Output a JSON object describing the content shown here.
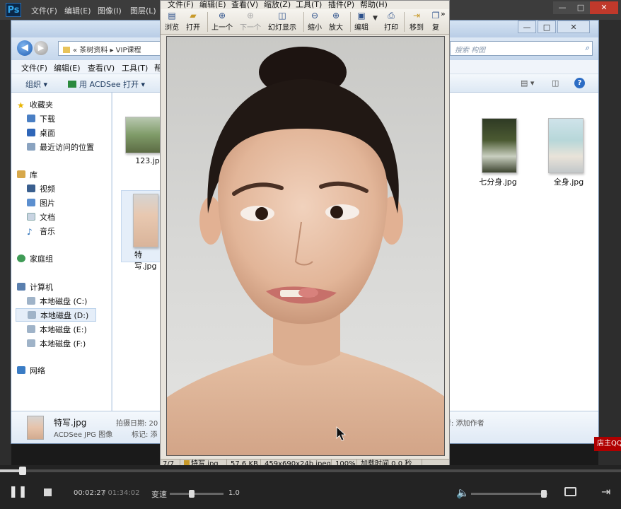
{
  "photoshop": {
    "logo": "Ps",
    "menus": [
      "文件(F)",
      "编辑(E)",
      "图像(I)",
      "图层(L)"
    ],
    "window_controls": [
      "—",
      "□",
      "✕"
    ]
  },
  "explorer": {
    "window_controls": [
      "—",
      "□",
      "✕"
    ],
    "address": "« 茶树资料 ▸ VIP课程",
    "search_placeholder": "搜索 构图",
    "menus": [
      "文件(F)",
      "编辑(E)",
      "查看(V)",
      "工具(T)",
      "帮"
    ],
    "commands": {
      "organize": "组织 ▾",
      "open_with": "用 ACDSee 打开 ▾"
    },
    "nav": {
      "favorites": {
        "label": "收藏夹",
        "items": [
          "下载",
          "桌面",
          "最近访问的位置"
        ]
      },
      "library": {
        "label": "库",
        "items": [
          "视频",
          "图片",
          "文档",
          "音乐"
        ]
      },
      "homegroup": "家庭组",
      "computer": {
        "label": "计算机",
        "items": [
          "本地磁盘 (C:)",
          "本地磁盘 (D:)",
          "本地磁盘 (E:)",
          "本地磁盘 (F:)"
        ],
        "selected": 1
      },
      "network": "网络"
    },
    "files": [
      {
        "name": "123.jpg"
      },
      {
        "name": "特写.jpg"
      },
      {
        "name": "七分身.jpg"
      },
      {
        "name": "全身.jpg"
      }
    ],
    "details": {
      "filename": "特写.jpg",
      "filetype": "ACDSee JPG 图像",
      "date_label": "拍摄日期: 20",
      "tags_label": "标记: 添",
      "author_label": "者: 添加作者"
    }
  },
  "acdsee": {
    "menus": [
      "文件(F)",
      "编辑(E)",
      "查看(V)",
      "缩放(Z)",
      "工具(T)",
      "插件(P)",
      "帮助(H)"
    ],
    "toolbar": [
      {
        "label": "浏览",
        "icon": "browse-icon",
        "glyph": "▤",
        "enabled": true
      },
      {
        "label": "打开",
        "icon": "folder-open-icon",
        "glyph": "▰",
        "enabled": true
      },
      {
        "label": "上一个",
        "icon": "prev-icon",
        "glyph": "⊕",
        "enabled": true
      },
      {
        "label": "下一个",
        "icon": "next-icon",
        "glyph": "⊕",
        "enabled": false
      },
      {
        "label": "幻灯显示",
        "icon": "slideshow-icon",
        "glyph": "◫",
        "enabled": true
      },
      {
        "label": "缩小",
        "icon": "zoom-out-icon",
        "glyph": "⊖",
        "enabled": true
      },
      {
        "label": "放大",
        "icon": "zoom-in-icon",
        "glyph": "⊕",
        "enabled": true
      },
      {
        "label": "编辑",
        "icon": "edit-icon",
        "glyph": "▣",
        "enabled": true
      },
      {
        "label": "打印",
        "icon": "print-icon",
        "glyph": "⎙",
        "enabled": true
      },
      {
        "label": "移到",
        "icon": "move-icon",
        "glyph": "⇥",
        "enabled": true
      },
      {
        "label": "复",
        "icon": "copy-icon",
        "glyph": "❐",
        "enabled": true
      }
    ],
    "overflow": "»",
    "status": [
      "7/7",
      "特写.jpg",
      "57.6 KB",
      "459x690x24b jpeg",
      "100%",
      "加载时间 0.0 秒"
    ]
  },
  "shop_tag": "店主QQ",
  "player": {
    "progress_fraction": 0.036,
    "current_time": "00:02:27",
    "total_time": "/ 01:34:02",
    "speed_label": "变速",
    "speed_value": "1.0",
    "volume_fraction": 0.95
  }
}
